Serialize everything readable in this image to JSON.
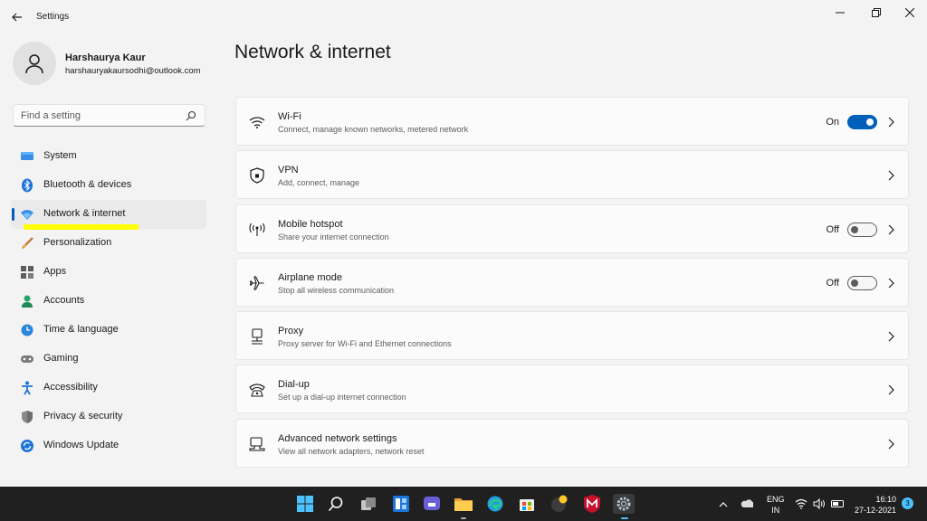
{
  "window": {
    "title": "Settings"
  },
  "user": {
    "name": "Harshaurya Kaur",
    "email": "harshauryakaursodhi@outlook.com"
  },
  "search": {
    "placeholder": "Find a setting"
  },
  "sidebar": {
    "items": [
      {
        "label": "System",
        "icon": "monitor-icon"
      },
      {
        "label": "Bluetooth & devices",
        "icon": "bluetooth-icon"
      },
      {
        "label": "Network & internet",
        "icon": "wifi-icon",
        "active": true
      },
      {
        "label": "Personalization",
        "icon": "brush-icon"
      },
      {
        "label": "Apps",
        "icon": "apps-icon"
      },
      {
        "label": "Accounts",
        "icon": "person-icon"
      },
      {
        "label": "Time & language",
        "icon": "globe-clock-icon"
      },
      {
        "label": "Gaming",
        "icon": "gamepad-icon"
      },
      {
        "label": "Accessibility",
        "icon": "accessibility-icon"
      },
      {
        "label": "Privacy & security",
        "icon": "shield-icon"
      },
      {
        "label": "Windows Update",
        "icon": "update-icon"
      }
    ]
  },
  "main": {
    "title": "Network & internet",
    "cards": [
      {
        "title": "Wi-Fi",
        "subtitle": "Connect, manage known networks, metered network",
        "icon": "wifi-icon",
        "toggle": "On"
      },
      {
        "title": "VPN",
        "subtitle": "Add, connect, manage",
        "icon": "vpn-shield-icon"
      },
      {
        "title": "Mobile hotspot",
        "subtitle": "Share your internet connection",
        "icon": "hotspot-icon",
        "toggle": "Off"
      },
      {
        "title": "Airplane mode",
        "subtitle": "Stop all wireless communication",
        "icon": "airplane-icon",
        "toggle": "Off"
      },
      {
        "title": "Proxy",
        "subtitle": "Proxy server for Wi-Fi and Ethernet connections",
        "icon": "proxy-icon"
      },
      {
        "title": "Dial-up",
        "subtitle": "Set up a dial-up internet connection",
        "icon": "dialup-icon"
      },
      {
        "title": "Advanced network settings",
        "subtitle": "View all network adapters, network reset",
        "icon": "advanced-network-icon"
      }
    ]
  },
  "taskbar": {
    "lang_line1": "ENG",
    "lang_line2": "IN",
    "time": "16:10",
    "date": "27-12-2021",
    "notifications": "3"
  },
  "colors": {
    "accent": "#005fb8",
    "highlight": "#ffff00",
    "taskbar": "#202020"
  }
}
